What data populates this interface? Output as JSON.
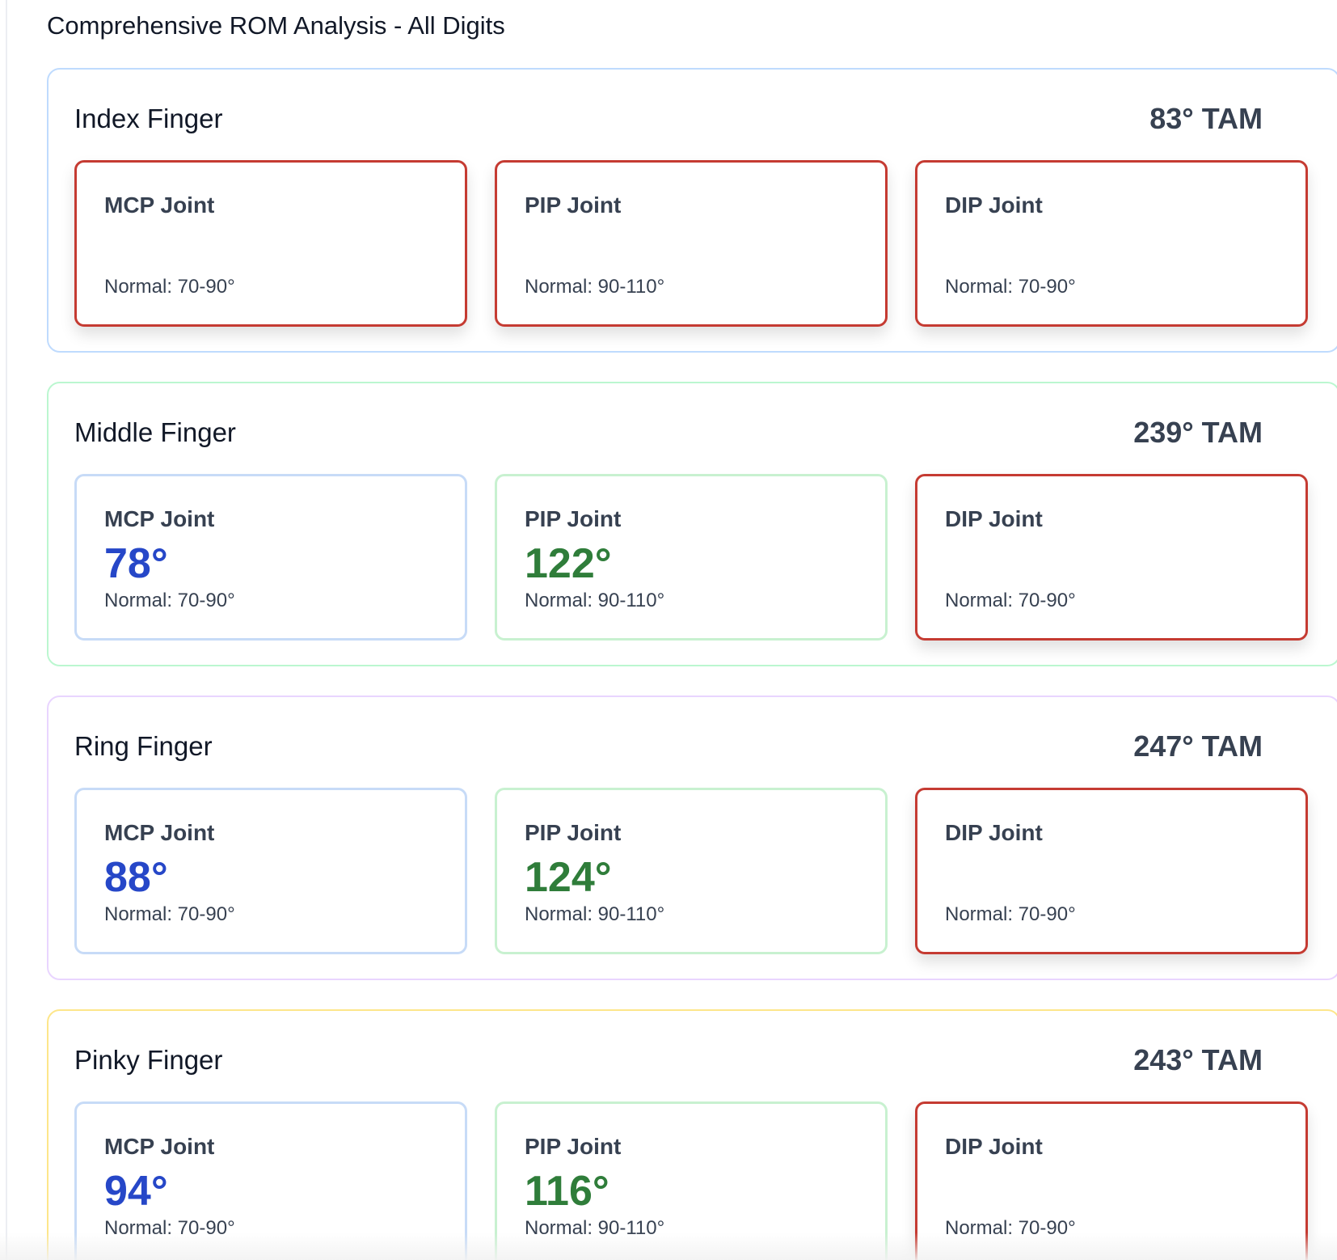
{
  "page": {
    "title": "Comprehensive ROM Analysis - All Digits"
  },
  "theme": {
    "finger_borders": {
      "index": "#bfdbfe",
      "middle": "#bbf7d0",
      "ring": "#e9d5ff",
      "pinky": "#fde68a"
    },
    "joint_colors": {
      "red_border": "#c53b32",
      "blue_value": "#2647c8",
      "green_value": "#2f7d3a"
    }
  },
  "fingers": [
    {
      "name": "Index Finger",
      "tam": "83° TAM",
      "joints": [
        {
          "label": "MCP Joint",
          "value": "",
          "normal": "Normal: 70-90°"
        },
        {
          "label": "PIP Joint",
          "value": "",
          "normal": "Normal: 90-110°"
        },
        {
          "label": "DIP Joint",
          "value": "",
          "normal": "Normal: 70-90°"
        }
      ]
    },
    {
      "name": "Middle Finger",
      "tam": "239° TAM",
      "joints": [
        {
          "label": "MCP Joint",
          "value": "78°",
          "normal": "Normal: 70-90°"
        },
        {
          "label": "PIP Joint",
          "value": "122°",
          "normal": "Normal: 90-110°"
        },
        {
          "label": "DIP Joint",
          "value": "",
          "normal": "Normal: 70-90°"
        }
      ]
    },
    {
      "name": "Ring Finger",
      "tam": "247° TAM",
      "joints": [
        {
          "label": "MCP Joint",
          "value": "88°",
          "normal": "Normal: 70-90°"
        },
        {
          "label": "PIP Joint",
          "value": "124°",
          "normal": "Normal: 90-110°"
        },
        {
          "label": "DIP Joint",
          "value": "",
          "normal": "Normal: 70-90°"
        }
      ]
    },
    {
      "name": "Pinky Finger",
      "tam": "243° TAM",
      "joints": [
        {
          "label": "MCP Joint",
          "value": "94°",
          "normal": "Normal: 70-90°"
        },
        {
          "label": "PIP Joint",
          "value": "116°",
          "normal": "Normal: 90-110°"
        },
        {
          "label": "DIP Joint",
          "value": "",
          "normal": "Normal: 70-90°"
        }
      ]
    }
  ]
}
